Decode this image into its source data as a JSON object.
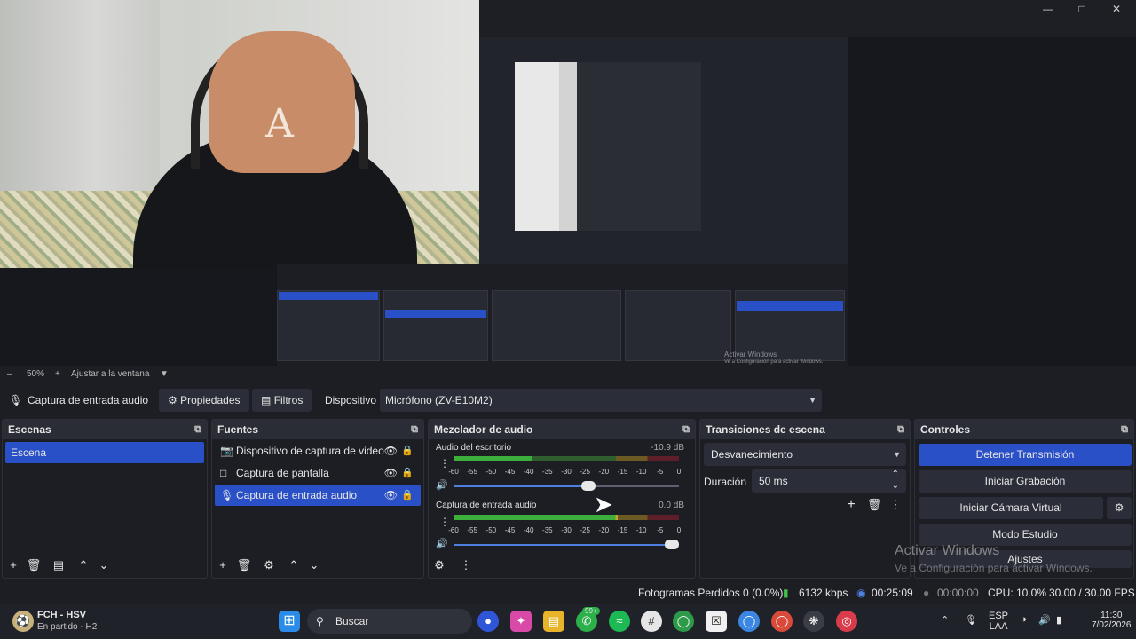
{
  "preview": {
    "zoom": "50%",
    "fit_label": "Ajustar a la ventana",
    "nested_activar": "Activar Windows",
    "nested_activar_sub": "Ve a Configuración para activar Windows."
  },
  "props": {
    "source_name": "Captura de entrada audio",
    "properties": "Propiedades",
    "filters": "Filtros",
    "device_label": "Dispositivo",
    "device_value": "Micrófono (ZV-E10M2)"
  },
  "scenes": {
    "title": "Escenas",
    "items": [
      "Escena"
    ]
  },
  "sources": {
    "title": "Fuentes",
    "items": [
      {
        "label": "Dispositivo de captura de video",
        "icon": "camera-icon"
      },
      {
        "label": "Captura de pantalla",
        "icon": "monitor-icon"
      },
      {
        "label": "Captura de entrada audio",
        "icon": "microphone-icon"
      }
    ]
  },
  "mixer": {
    "title": "Mezclador de audio",
    "scale": [
      "-60",
      "-55",
      "-50",
      "-45",
      "-40",
      "-35",
      "-30",
      "-25",
      "-20",
      "-15",
      "-10",
      "-5",
      "0"
    ],
    "channels": [
      {
        "name": "Audio del escritorio",
        "db": "-10.9 dB",
        "level": 0.35,
        "fader": 0.63
      },
      {
        "name": "Captura de entrada audio",
        "db": "0.0 dB",
        "level": 0.73,
        "fader": 1.0
      }
    ]
  },
  "transitions": {
    "title": "Transiciones de escena",
    "selected": "Desvanecimiento",
    "duration_label": "Duración",
    "duration_value": "50 ms"
  },
  "controls": {
    "title": "Controles",
    "stop_stream": "Detener Transmisión",
    "start_recording": "Iniciar Grabación",
    "start_virtual_cam": "Iniciar Cámara Virtual",
    "studio_mode": "Modo Estudio",
    "settings": "Ajustes"
  },
  "watermark": {
    "title": "Activar Windows",
    "subtitle": "Ve a Configuración para activar Windows."
  },
  "status": {
    "dropped": "Fotogramas Perdidos 0 (0.0%)",
    "bitrate": "6132 kbps",
    "stream_time": "00:25:09",
    "rec_time": "00:00:00",
    "cpu": "CPU: 10.0%",
    "fps": "30.00 / 30.00 FPS"
  },
  "taskbar": {
    "weather_title": "FCH - HSV",
    "weather_sub": "En partido - H2",
    "search": "Buscar",
    "lang1": "ESP",
    "lang2": "LAA",
    "time": "11:30",
    "date": "7/02/2026",
    "badge": "99+"
  },
  "colors": {
    "accent": "#2a50c8",
    "meter_green": "#3cae3c",
    "meter_yellow": "#c8a22a",
    "meter_red": "#b8263a"
  }
}
